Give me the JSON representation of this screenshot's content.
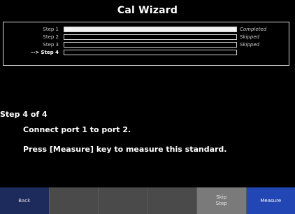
{
  "window": {
    "title": "Cal Wizard"
  },
  "steps": [
    {
      "label": "Step 1",
      "status": "Completed",
      "current": false,
      "progress": 1.0
    },
    {
      "label": "Step 2",
      "status": "Skipped",
      "current": false,
      "progress": 0.0
    },
    {
      "label": "Step 3",
      "status": "Skipped",
      "current": false,
      "progress": 0.0
    },
    {
      "label": "--> Step 4",
      "status": "",
      "current": true,
      "progress": 0.0
    }
  ],
  "instructions": {
    "heading": "Step 4 of 4",
    "line1": "Connect port 1 to port 2.",
    "line2": "Press [Measure] key to measure this standard."
  },
  "softkeys": {
    "back": "Back",
    "key2": "",
    "key3": "",
    "key4": "",
    "skip": "Skip\nStep",
    "measure": "Measure"
  },
  "colors": {
    "background": "#000000",
    "softkey_blue": "#2246b4",
    "softkey_dark": "#1c2a5c",
    "softkey_gray": "#4a4a4a"
  }
}
